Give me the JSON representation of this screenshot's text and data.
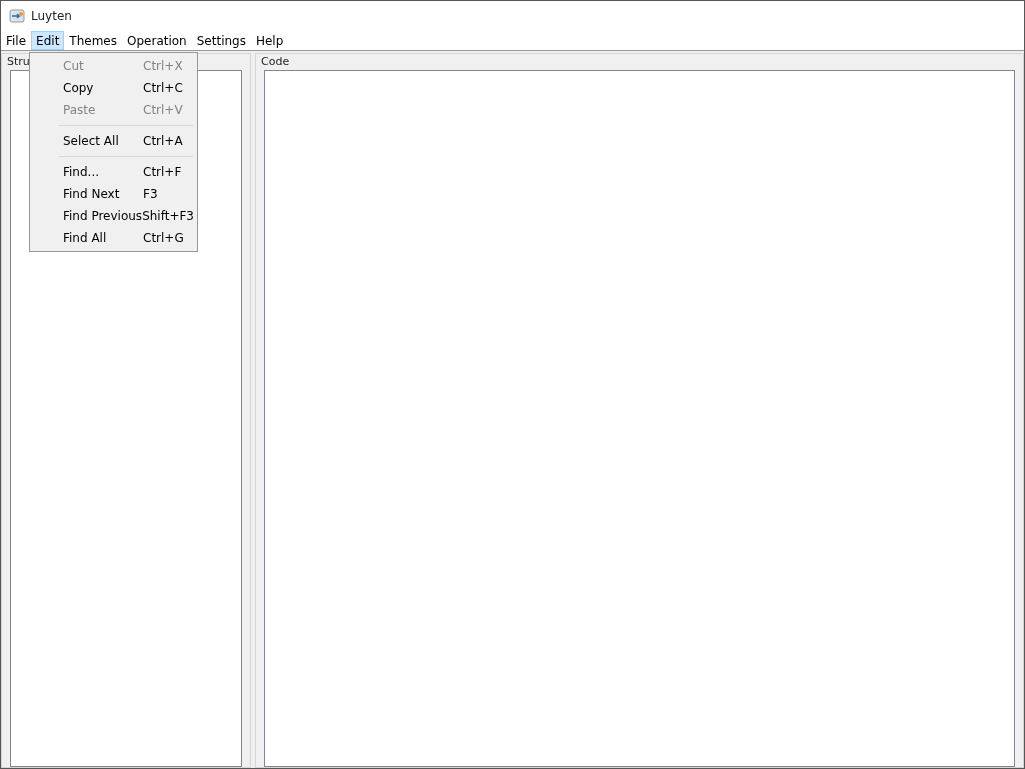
{
  "window": {
    "title": "Luyten"
  },
  "menu_bar": [
    {
      "label": "File",
      "selected": false
    },
    {
      "label": "Edit",
      "selected": true
    },
    {
      "label": "Themes",
      "selected": false
    },
    {
      "label": "Operation",
      "selected": false
    },
    {
      "label": "Settings",
      "selected": false
    },
    {
      "label": "Help",
      "selected": false
    }
  ],
  "edit_menu": [
    {
      "kind": "item",
      "label": "Cut",
      "shortcut": "Ctrl+X",
      "disabled": true
    },
    {
      "kind": "item",
      "label": "Copy",
      "shortcut": "Ctrl+C",
      "disabled": false
    },
    {
      "kind": "item",
      "label": "Paste",
      "shortcut": "Ctrl+V",
      "disabled": true
    },
    {
      "kind": "separator"
    },
    {
      "kind": "item",
      "label": "Select All",
      "shortcut": "Ctrl+A",
      "disabled": false
    },
    {
      "kind": "separator"
    },
    {
      "kind": "item",
      "label": "Find...",
      "shortcut": "Ctrl+F",
      "disabled": false
    },
    {
      "kind": "item",
      "label": "Find Next",
      "shortcut": "F3",
      "disabled": false
    },
    {
      "kind": "item",
      "label": "Find Previous",
      "shortcut": "Shift+F3",
      "disabled": false
    },
    {
      "kind": "item",
      "label": "Find All",
      "shortcut": "Ctrl+G",
      "disabled": false
    }
  ],
  "structure_panel": {
    "title": "Stru"
  },
  "code_panel": {
    "title": "Code"
  }
}
